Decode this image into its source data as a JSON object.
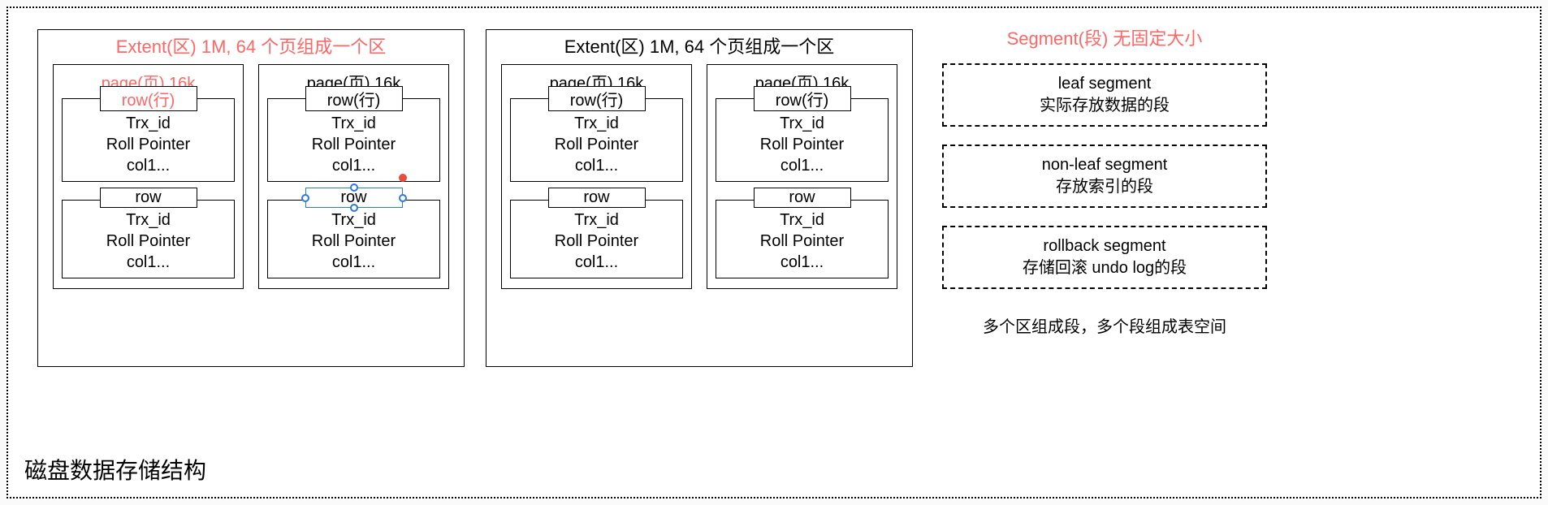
{
  "footerTitle": "磁盘数据存储结构",
  "extent1": {
    "title": "Extent(区) 1M, 64 个页组成一个区",
    "pages": [
      {
        "title": "page(页) 16k",
        "titleRed": true,
        "rows": [
          {
            "label": "row(行)",
            "labelRed": true,
            "l1": "Trx_id",
            "l2": "Roll Pointer",
            "l3": "col1...",
            "selected": false
          },
          {
            "label": "row",
            "labelRed": false,
            "l1": "Trx_id",
            "l2": "Roll Pointer",
            "l3": "col1...",
            "selected": false
          }
        ]
      },
      {
        "title": "page(页) 16k",
        "titleRed": false,
        "rows": [
          {
            "label": "row(行)",
            "labelRed": false,
            "l1": "Trx_id",
            "l2": "Roll Pointer",
            "l3": "col1...",
            "selected": false
          },
          {
            "label": "row",
            "labelRed": false,
            "l1": "Trx_id",
            "l2": "Roll Pointer",
            "l3": "col1...",
            "selected": true
          }
        ]
      }
    ]
  },
  "extent2": {
    "title": "Extent(区) 1M, 64 个页组成一个区",
    "pages": [
      {
        "title": "page(页) 16k",
        "rows": [
          {
            "label": "row(行)",
            "l1": "Trx_id",
            "l2": "Roll Pointer",
            "l3": "col1..."
          },
          {
            "label": "row",
            "l1": "Trx_id",
            "l2": "Roll Pointer",
            "l3": "col1..."
          }
        ]
      },
      {
        "title": "page(页) 16k",
        "rows": [
          {
            "label": "row(行)",
            "l1": "Trx_id",
            "l2": "Roll Pointer",
            "l3": "col1..."
          },
          {
            "label": "row",
            "l1": "Trx_id",
            "l2": "Roll Pointer",
            "l3": "col1..."
          }
        ]
      }
    ]
  },
  "segment": {
    "header": "Segment(段) 无固定大小",
    "boxes": [
      {
        "l1": "leaf segment",
        "l2": "实际存放数据的段"
      },
      {
        "l1": "non-leaf segment",
        "l2": "存放索引的段"
      },
      {
        "l1": "rollback segment",
        "l2": "存储回滚 undo log的段"
      }
    ],
    "caption": "多个区组成段，多个段组成表空间"
  }
}
